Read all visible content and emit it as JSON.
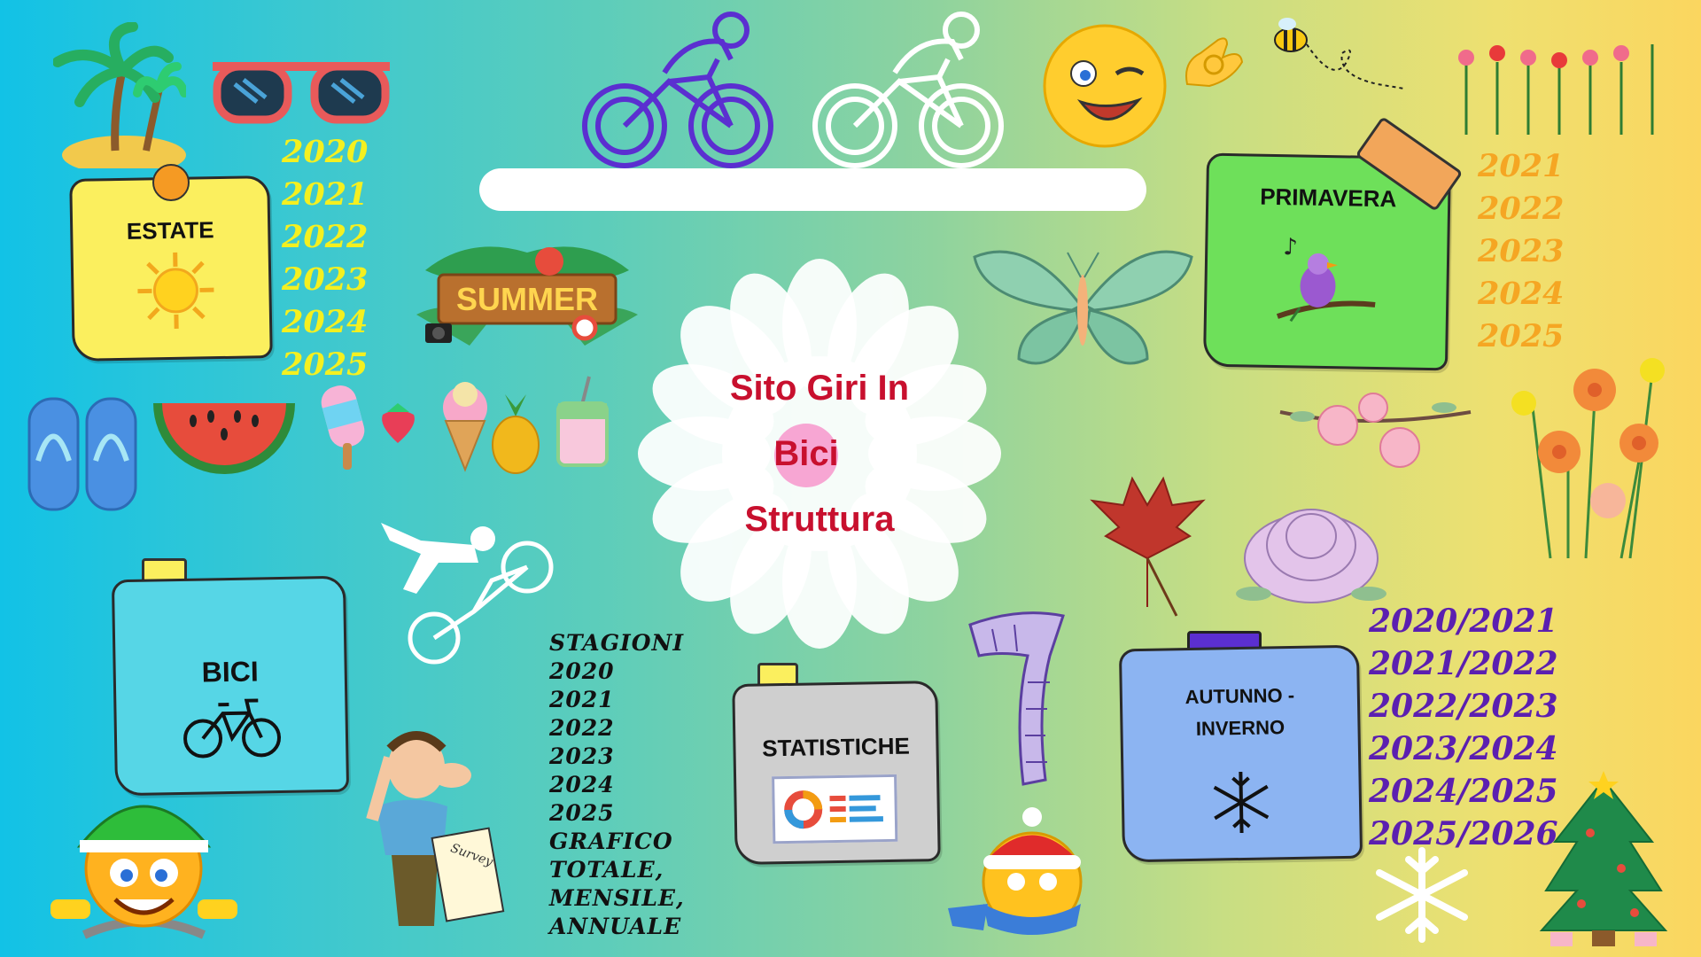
{
  "center": {
    "line1": "Sito Giri In",
    "line2": "Bici",
    "line3": "Struttura"
  },
  "estate": {
    "title": "ESTATE",
    "years": [
      "2020",
      "2021",
      "2022",
      "2023",
      "2024",
      "2025"
    ],
    "year_color": "#f4f020"
  },
  "summer_sign": "SUMMER",
  "primavera": {
    "title": "PRIMAVERA",
    "years": [
      "2021",
      "2022",
      "2023",
      "2024",
      "2025"
    ],
    "year_color": "#f5a623"
  },
  "bici": {
    "title": "BICI"
  },
  "statistiche": {
    "title": "STATISTICHE"
  },
  "autunno": {
    "title_line1": "AUTUNNO -",
    "title_line2": "INVERNO",
    "years": [
      "2020/2021",
      "2021/2022",
      "2022/2023",
      "2023/2024",
      "2024/2025",
      "2025/2026"
    ],
    "year_color": "#5b1fb0"
  },
  "stats_list": [
    "STAGIONI",
    "2020",
    "2021",
    "2022",
    "2023",
    "2024",
    "2025",
    "GRAFICO",
    "TOTALE,",
    "MENSILE,",
    "ANNUALE"
  ],
  "survey_label": "Survey",
  "icons": [
    "palm-tree-icon",
    "sunglasses-icon",
    "sun-icon",
    "flip-flops-icon",
    "watermelon-icon",
    "popsicle-icon",
    "strawberry-icon",
    "ice-cream-icon",
    "pineapple-icon",
    "drink-icon",
    "cyclist-purple-icon",
    "cyclist-white-icon",
    "winking-emoji-icon",
    "ok-hand-icon",
    "bee-icon",
    "tulips-icon",
    "butterfly-icon",
    "bird-icon",
    "cherry-blossom-icon",
    "daffodils-icon",
    "maple-leaf-icon",
    "peony-icon",
    "scarf-icon",
    "snowflake-icon",
    "christmas-tree-icon",
    "santa-emoji-icon",
    "bmx-rider-icon",
    "bicycle-icon",
    "helmet-emoji-icon",
    "thinking-man-icon",
    "chart-icon"
  ]
}
